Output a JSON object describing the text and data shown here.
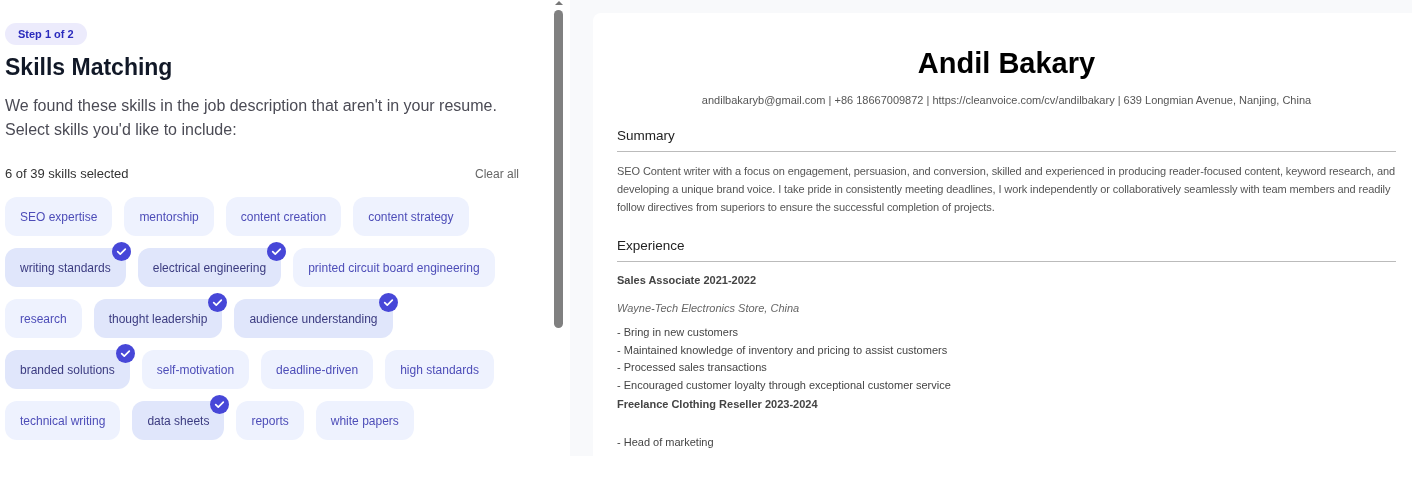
{
  "step_badge": "Step 1 of 2",
  "title": "Skills Matching",
  "intro": "We found these skills in the job description that aren't in your resume. Select skills you'd like to include:",
  "selection_count": "6 of 39 skills selected",
  "clear_button": "Clear all",
  "skill_rows": [
    [
      {
        "label": "SEO expertise",
        "selected": false
      },
      {
        "label": "mentorship",
        "selected": false
      },
      {
        "label": "content creation",
        "selected": false
      },
      {
        "label": "content strategy",
        "selected": false
      }
    ],
    [
      {
        "label": "writing standards",
        "selected": true
      },
      {
        "label": "electrical engineering",
        "selected": true
      },
      {
        "label": "printed circuit board engineering",
        "selected": false
      }
    ],
    [
      {
        "label": "research",
        "selected": false
      },
      {
        "label": "thought leadership",
        "selected": true
      },
      {
        "label": "audience understanding",
        "selected": true
      }
    ],
    [
      {
        "label": "branded solutions",
        "selected": true
      },
      {
        "label": "self-motivation",
        "selected": false
      },
      {
        "label": "deadline-driven",
        "selected": false
      },
      {
        "label": "high standards",
        "selected": false
      }
    ],
    [
      {
        "label": "technical writing",
        "selected": false
      },
      {
        "label": "data sheets",
        "selected": true
      },
      {
        "label": "reports",
        "selected": false
      },
      {
        "label": "white papers",
        "selected": false
      }
    ]
  ],
  "resume": {
    "name": "Andil Bakary",
    "contact": "andilbakaryb@gmail.com | +86 18667009872 | https://cleanvoice.com/cv/andilbakary | 639 Longmian Avenue, Nanjing, China",
    "sections": [
      {
        "heading": "Summary",
        "blocks": [
          {
            "kind": "paragraph",
            "text": "SEO Content writer with a focus on engagement, persuasion, and conversion, skilled and experienced in producing reader-focused content, keyword research, and developing a unique brand voice. I take pride in consistently meeting deadlines, I work independently or collaboratively seamlessly with team members and readily follow directives from superiors to ensure the successful completion of projects."
          }
        ]
      },
      {
        "heading": "Experience",
        "blocks": [
          {
            "kind": "job_title",
            "text": "Sales Associate 2021-2022"
          },
          {
            "kind": "employer",
            "text": "Wayne-Tech Electronics Store, China"
          },
          {
            "kind": "bullets",
            "items": [
              "- Bring in new customers",
              "- Maintained knowledge of inventory and pricing to assist customers",
              "- Processed sales transactions",
              "- Encouraged customer loyalty through exceptional customer service"
            ]
          },
          {
            "kind": "job_title",
            "text": "Freelance Clothing Reseller 2023-2024"
          },
          {
            "kind": "bullets",
            "items": [
              "- Head of marketing"
            ]
          }
        ]
      }
    ]
  }
}
